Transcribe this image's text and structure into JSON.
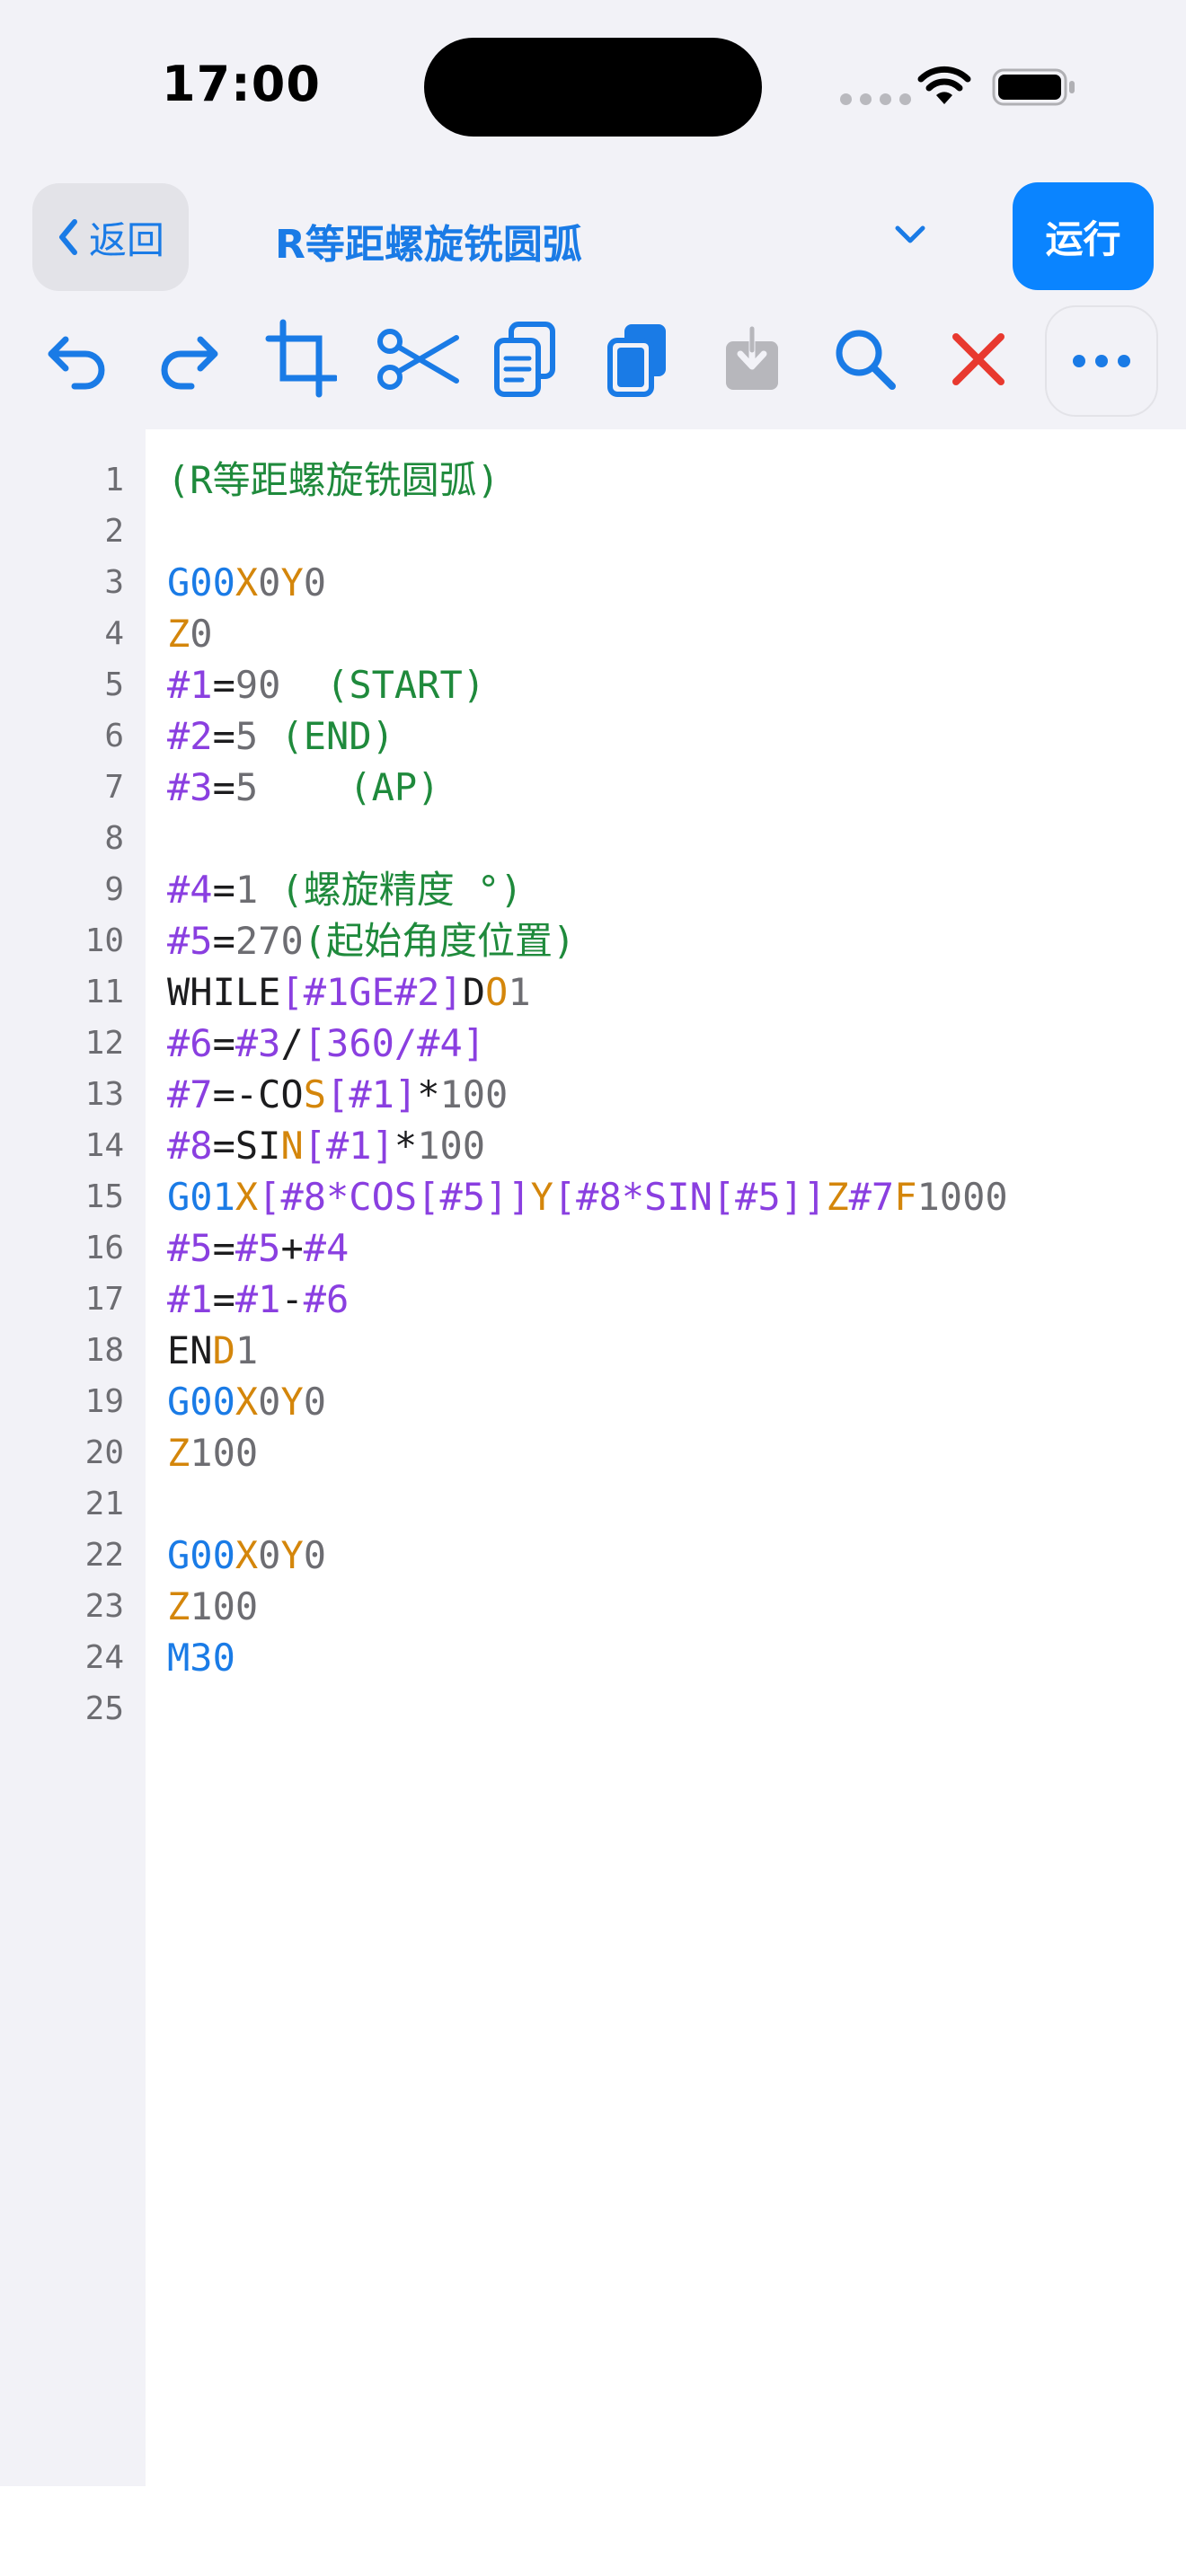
{
  "status_bar": {
    "time": "17:00"
  },
  "nav": {
    "back_label": "返回",
    "title": "R等距螺旋铣圆弧",
    "run_label": "运行"
  },
  "toolbar": {
    "icons": [
      "undo-icon",
      "redo-icon",
      "crop-icon",
      "scissors-icon",
      "copy-icon",
      "paste-icon",
      "save-download-icon",
      "search-icon",
      "close-icon",
      "more-icon"
    ]
  },
  "colors": {
    "comment": "#1f8a3c",
    "g_code": "#1a7be6",
    "axis": "#d4860b",
    "number": "#6d6d72",
    "variable": "#8a3fe0",
    "accent": "#0a84ff",
    "delete": "#e8392f"
  },
  "editor": {
    "lines": [
      {
        "n": "1",
        "tokens": [
          [
            "c",
            "(R等距螺旋铣圆弧)"
          ]
        ]
      },
      {
        "n": "2",
        "tokens": []
      },
      {
        "n": "3",
        "tokens": [
          [
            "g",
            "G00"
          ],
          [
            "a",
            "X"
          ],
          [
            "n",
            "0"
          ],
          [
            "a",
            "Y"
          ],
          [
            "n",
            "0"
          ]
        ]
      },
      {
        "n": "4",
        "tokens": [
          [
            "a",
            "Z"
          ],
          [
            "n",
            "0"
          ]
        ]
      },
      {
        "n": "5",
        "tokens": [
          [
            "v",
            "#1"
          ],
          [
            "t",
            "="
          ],
          [
            "n",
            "90"
          ],
          [
            "t",
            "  "
          ],
          [
            "c",
            "(START)"
          ]
        ]
      },
      {
        "n": "6",
        "tokens": [
          [
            "v",
            "#2"
          ],
          [
            "t",
            "="
          ],
          [
            "n",
            "5"
          ],
          [
            "t",
            " "
          ],
          [
            "c",
            "(END)"
          ]
        ]
      },
      {
        "n": "7",
        "tokens": [
          [
            "v",
            "#3"
          ],
          [
            "t",
            "="
          ],
          [
            "n",
            "5"
          ],
          [
            "t",
            "    "
          ],
          [
            "c",
            "(AP)"
          ]
        ]
      },
      {
        "n": "8",
        "tokens": []
      },
      {
        "n": "9",
        "tokens": [
          [
            "v",
            "#4"
          ],
          [
            "t",
            "="
          ],
          [
            "n",
            "1"
          ],
          [
            "t",
            " "
          ],
          [
            "c",
            "(螺旋精度 °)"
          ]
        ]
      },
      {
        "n": "10",
        "tokens": [
          [
            "v",
            "#5"
          ],
          [
            "t",
            "="
          ],
          [
            "n",
            "270"
          ],
          [
            "c",
            "(起始角度位置)"
          ]
        ]
      },
      {
        "n": "11",
        "tokens": [
          [
            "t",
            "WHILE"
          ],
          [
            "v",
            "[#1GE#2]"
          ],
          [
            "t",
            "D"
          ],
          [
            "a",
            "O"
          ],
          [
            "n",
            "1"
          ]
        ]
      },
      {
        "n": "12",
        "tokens": [
          [
            "v",
            "#6"
          ],
          [
            "t",
            "="
          ],
          [
            "v",
            "#3"
          ],
          [
            "t",
            "/"
          ],
          [
            "v",
            "[360/#4]"
          ]
        ]
      },
      {
        "n": "13",
        "tokens": [
          [
            "v",
            "#7"
          ],
          [
            "t",
            "=-CO"
          ],
          [
            "a",
            "S"
          ],
          [
            "v",
            "[#1]"
          ],
          [
            "t",
            "*"
          ],
          [
            "n",
            "100"
          ]
        ]
      },
      {
        "n": "14",
        "tokens": [
          [
            "v",
            "#8"
          ],
          [
            "t",
            "=SI"
          ],
          [
            "a",
            "N"
          ],
          [
            "v",
            "[#1]"
          ],
          [
            "t",
            "*"
          ],
          [
            "n",
            "100"
          ]
        ]
      },
      {
        "n": "15",
        "tokens": [
          [
            "g",
            "G01"
          ],
          [
            "a",
            "X"
          ],
          [
            "v",
            "[#8*COS[#5]]"
          ],
          [
            "a",
            "Y"
          ],
          [
            "v",
            "[#8*SIN[#5]]"
          ],
          [
            "a",
            "Z"
          ],
          [
            "v",
            "#7"
          ],
          [
            "a",
            "F"
          ],
          [
            "n",
            "1000"
          ]
        ]
      },
      {
        "n": "16",
        "tokens": [
          [
            "v",
            "#5"
          ],
          [
            "t",
            "="
          ],
          [
            "v",
            "#5"
          ],
          [
            "t",
            "+"
          ],
          [
            "v",
            "#4"
          ]
        ]
      },
      {
        "n": "17",
        "tokens": [
          [
            "v",
            "#1"
          ],
          [
            "t",
            "="
          ],
          [
            "v",
            "#1"
          ],
          [
            "t",
            "-"
          ],
          [
            "v",
            "#6"
          ]
        ]
      },
      {
        "n": "18",
        "tokens": [
          [
            "t",
            "EN"
          ],
          [
            "a",
            "D"
          ],
          [
            "n",
            "1"
          ]
        ]
      },
      {
        "n": "19",
        "tokens": [
          [
            "g",
            "G00"
          ],
          [
            "a",
            "X"
          ],
          [
            "n",
            "0"
          ],
          [
            "a",
            "Y"
          ],
          [
            "n",
            "0"
          ]
        ]
      },
      {
        "n": "20",
        "tokens": [
          [
            "a",
            "Z"
          ],
          [
            "n",
            "100"
          ]
        ]
      },
      {
        "n": "21",
        "tokens": []
      },
      {
        "n": "22",
        "tokens": [
          [
            "g",
            "G00"
          ],
          [
            "a",
            "X"
          ],
          [
            "n",
            "0"
          ],
          [
            "a",
            "Y"
          ],
          [
            "n",
            "0"
          ]
        ]
      },
      {
        "n": "23",
        "tokens": [
          [
            "a",
            "Z"
          ],
          [
            "n",
            "100"
          ]
        ]
      },
      {
        "n": "24",
        "tokens": [
          [
            "g",
            "M30"
          ]
        ]
      },
      {
        "n": "25",
        "tokens": []
      }
    ]
  }
}
